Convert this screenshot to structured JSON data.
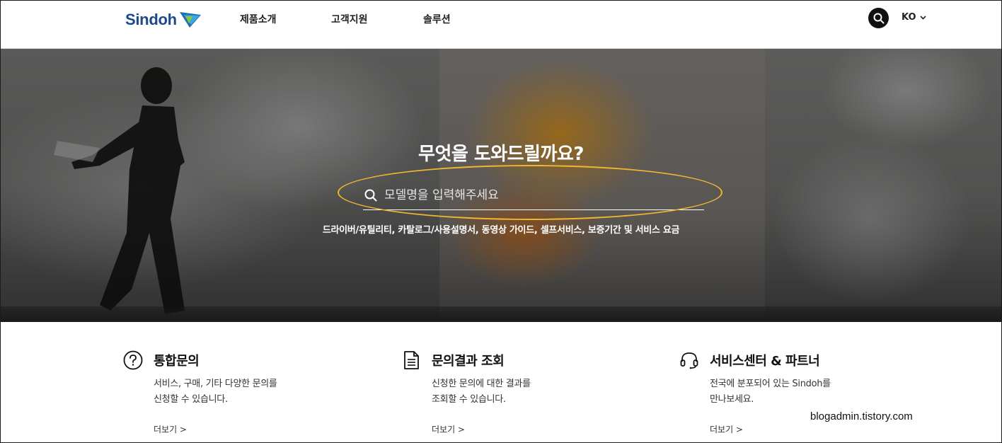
{
  "header": {
    "logo_text": "Sindoh",
    "nav": [
      {
        "label": "제품소개"
      },
      {
        "label": "고객지원"
      },
      {
        "label": "솔루션"
      }
    ],
    "search_icon": "search-icon",
    "language": "KO"
  },
  "hero": {
    "title": "무엇을 도와드릴까요?",
    "search_placeholder": "모델명을 입력해주세요",
    "quick_links": "드라이버/유틸리티, 카탈로그/사용설명서, 동영상 가이드, 셀프서비스, 보증기간 및 서비스 요금",
    "highlight_color": "#f0b632"
  },
  "cards": [
    {
      "icon": "question-circle-icon",
      "title": "통합문의",
      "desc": "서비스, 구매, 기타 다양한 문의를\n신청할 수 있습니다.",
      "more": "더보기 >"
    },
    {
      "icon": "document-icon",
      "title": "문의결과 조회",
      "desc": "신청한 문의에 대한 결과를\n조회할 수 있습니다.",
      "more": "더보기 >"
    },
    {
      "icon": "headset-icon",
      "title": "서비스센터 & 파트너",
      "desc": "전국에 분포되어 있는 Sindoh를\n만나보세요.",
      "more": "더보기 >"
    }
  ],
  "watermark": "blogadmin.tistory.com"
}
